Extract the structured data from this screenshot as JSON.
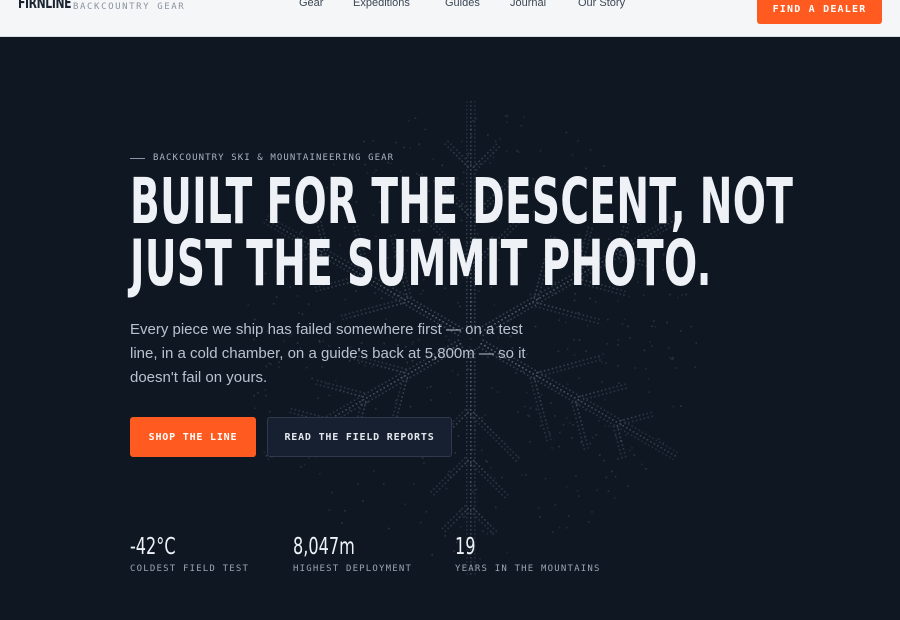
{
  "header": {
    "logo": "FIRNLINE",
    "tagline": "BACKCOUNTRY GEAR",
    "nav": [
      "Gear",
      "Expeditions",
      "Guides",
      "Journal",
      "Our Story"
    ],
    "cta": "FIND A DEALER"
  },
  "hero": {
    "eyebrow": "BACKCOUNTRY SKI & MOUNTAINEERING GEAR",
    "headline": [
      "BUILT FOR THE DESCENT, NOT",
      "JUST THE SUMMIT PHOTO."
    ],
    "subcopy": "Every piece we ship has failed somewhere first — on a test line, in a cold chamber, on a guide's back at 5,800m — so it doesn't fail on yours.",
    "primary_button": "SHOP THE LINE",
    "secondary_button": "READ THE FIELD REPORTS",
    "stats": [
      {
        "value": "-42°C",
        "label": "COLDEST FIELD TEST"
      },
      {
        "value": "8,047m",
        "label": "HIGHEST DEPLOYMENT"
      },
      {
        "value": "19",
        "label": "YEARS IN THE MOUNTAINS"
      }
    ]
  },
  "colors": {
    "accent": "#ff5a1f",
    "hero_bg": "#0f1722",
    "header_bg": "#f4f6f8"
  }
}
